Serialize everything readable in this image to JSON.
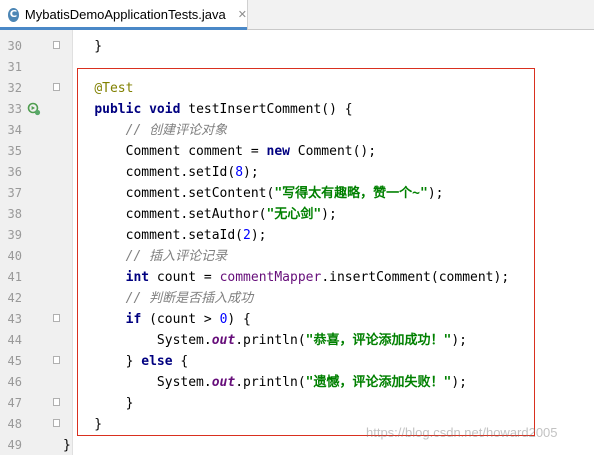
{
  "tab": {
    "title": "MybatisDemoApplicationTests.java",
    "icon": "class-icon",
    "icon_letter": "C"
  },
  "watermark": "https://blog.csdn.net/howard2005",
  "lines": [
    {
      "n": "30",
      "tokens": [
        {
          "t": "    }",
          "c": ""
        }
      ]
    },
    {
      "n": "31",
      "tokens": []
    },
    {
      "n": "32",
      "tokens": [
        {
          "t": "    ",
          "c": ""
        },
        {
          "t": "@Test",
          "c": "ann"
        }
      ]
    },
    {
      "n": "33",
      "tokens": [
        {
          "t": "    ",
          "c": ""
        },
        {
          "t": "public",
          "c": "kw"
        },
        {
          "t": " ",
          "c": ""
        },
        {
          "t": "void",
          "c": "kw"
        },
        {
          "t": " testInsertComment() {",
          "c": ""
        }
      ]
    },
    {
      "n": "34",
      "tokens": [
        {
          "t": "        ",
          "c": ""
        },
        {
          "t": "// 创建评论对象",
          "c": "cmt"
        }
      ]
    },
    {
      "n": "35",
      "tokens": [
        {
          "t": "        Comment comment = ",
          "c": ""
        },
        {
          "t": "new",
          "c": "kw"
        },
        {
          "t": " Comment();",
          "c": ""
        }
      ]
    },
    {
      "n": "36",
      "tokens": [
        {
          "t": "        comment.setId(",
          "c": ""
        },
        {
          "t": "8",
          "c": "num"
        },
        {
          "t": ");",
          "c": ""
        }
      ]
    },
    {
      "n": "37",
      "tokens": [
        {
          "t": "        comment.setContent(",
          "c": ""
        },
        {
          "t": "\"写得太有趣略，赞一个~\"",
          "c": "str"
        },
        {
          "t": ");",
          "c": ""
        }
      ]
    },
    {
      "n": "38",
      "tokens": [
        {
          "t": "        comment.setAuthor(",
          "c": ""
        },
        {
          "t": "\"无心剑\"",
          "c": "str"
        },
        {
          "t": ");",
          "c": ""
        }
      ]
    },
    {
      "n": "39",
      "tokens": [
        {
          "t": "        comment.setaId(",
          "c": ""
        },
        {
          "t": "2",
          "c": "num"
        },
        {
          "t": ");",
          "c": ""
        }
      ]
    },
    {
      "n": "40",
      "tokens": [
        {
          "t": "        ",
          "c": ""
        },
        {
          "t": "// 插入评论记录",
          "c": "cmt"
        }
      ]
    },
    {
      "n": "41",
      "tokens": [
        {
          "t": "        ",
          "c": ""
        },
        {
          "t": "int",
          "c": "kw"
        },
        {
          "t": " count = ",
          "c": ""
        },
        {
          "t": "commentMapper",
          "c": "ref"
        },
        {
          "t": ".insertComment(comment);",
          "c": ""
        }
      ]
    },
    {
      "n": "42",
      "tokens": [
        {
          "t": "        ",
          "c": ""
        },
        {
          "t": "// 判断是否插入成功",
          "c": "cmt"
        }
      ]
    },
    {
      "n": "43",
      "tokens": [
        {
          "t": "        ",
          "c": ""
        },
        {
          "t": "if",
          "c": "kw"
        },
        {
          "t": " (count > ",
          "c": ""
        },
        {
          "t": "0",
          "c": "num"
        },
        {
          "t": ") {",
          "c": ""
        }
      ]
    },
    {
      "n": "44",
      "tokens": [
        {
          "t": "            System.",
          "c": ""
        },
        {
          "t": "out",
          "c": "field"
        },
        {
          "t": ".println(",
          "c": ""
        },
        {
          "t": "\"恭喜，评论添加成功！\"",
          "c": "str"
        },
        {
          "t": ");",
          "c": ""
        }
      ]
    },
    {
      "n": "45",
      "tokens": [
        {
          "t": "        } ",
          "c": ""
        },
        {
          "t": "else",
          "c": "kw"
        },
        {
          "t": " {",
          "c": ""
        }
      ]
    },
    {
      "n": "46",
      "tokens": [
        {
          "t": "            System.",
          "c": ""
        },
        {
          "t": "out",
          "c": "field"
        },
        {
          "t": ".println(",
          "c": ""
        },
        {
          "t": "\"遗憾，评论添加失败！\"",
          "c": "str"
        },
        {
          "t": ");",
          "c": ""
        }
      ]
    },
    {
      "n": "47",
      "tokens": [
        {
          "t": "        }",
          "c": ""
        }
      ]
    },
    {
      "n": "48",
      "tokens": [
        {
          "t": "    }",
          "c": ""
        }
      ]
    },
    {
      "n": "49",
      "tokens": [
        {
          "t": "}",
          "c": ""
        }
      ]
    }
  ],
  "folds": [
    "30",
    "32",
    "43",
    "45",
    "47",
    "48"
  ],
  "run_gutter_line": "33"
}
